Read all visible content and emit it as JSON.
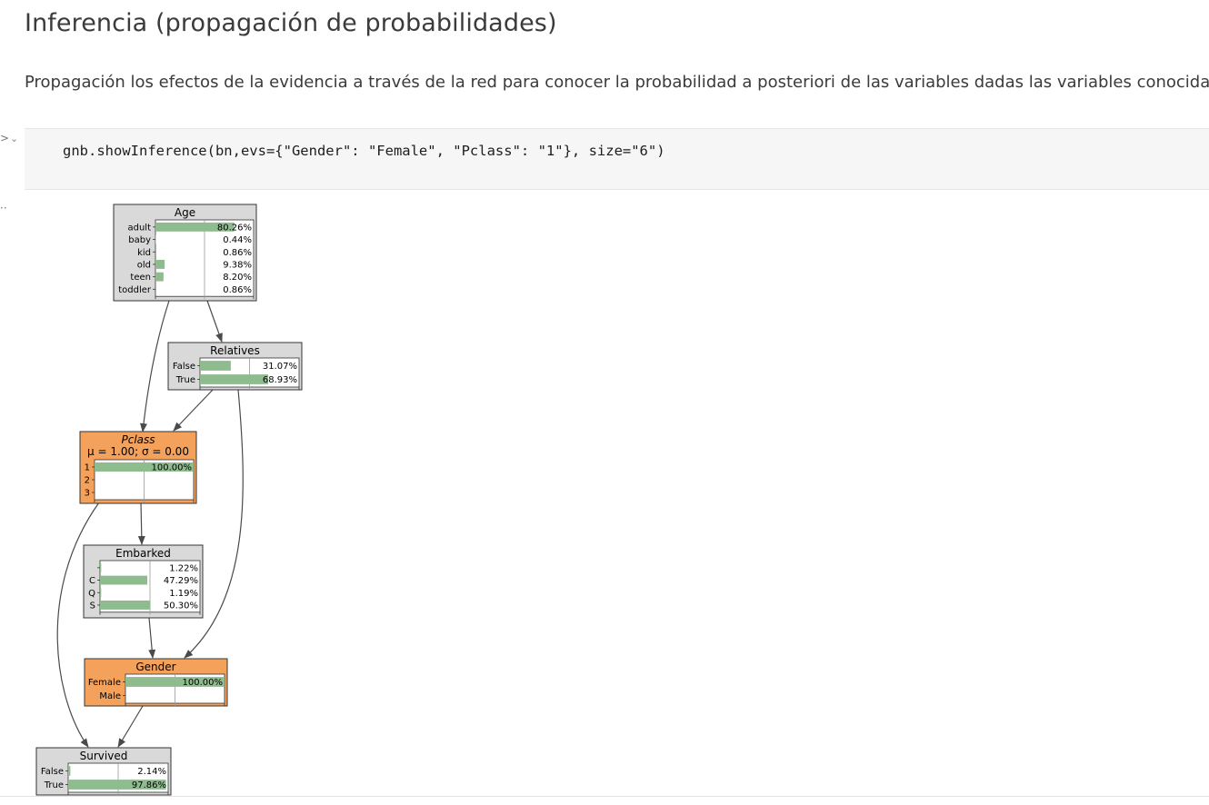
{
  "heading": "Inferencia (propagación de probabilidades)",
  "paragraph": "Propagación los efectos de la evidencia a través de la red para conocer la probabilidad a posteriori de las variables dadas las variables conocidas",
  "cell": {
    "prompt": ">",
    "collapse_icon": "chevron-down-icon",
    "code": "gnb.showInference(bn,evs={\"Gender\": \"Female\", \"Pclass\": \"1\"}, size=\"6\")",
    "output_prompt": "··"
  },
  "colors": {
    "bar": "#8fbc8f",
    "node_default": "#d9d9d9",
    "node_evidence": "#f4a15b",
    "edge": "#4a4a4a",
    "cell_bg": "#f6f6f6"
  },
  "nodes": {
    "age": {
      "title": "Age",
      "evidence": false,
      "states": [
        {
          "label": "adult",
          "value": 0.8026,
          "text": "80.26%"
        },
        {
          "label": "baby",
          "value": 0.0044,
          "text": "0.44%"
        },
        {
          "label": "kid",
          "value": 0.0086,
          "text": "0.86%"
        },
        {
          "label": "old",
          "value": 0.0938,
          "text": "9.38%"
        },
        {
          "label": "teen",
          "value": 0.082,
          "text": "8.20%"
        },
        {
          "label": "toddler",
          "value": 0.0086,
          "text": "0.86%"
        }
      ]
    },
    "relatives": {
      "title": "Relatives",
      "evidence": false,
      "states": [
        {
          "label": "False",
          "value": 0.3107,
          "text": "31.07%"
        },
        {
          "label": "True",
          "value": 0.6893,
          "text": "68.93%"
        }
      ]
    },
    "pclass": {
      "title": "Pclass",
      "subtitle": "μ = 1.00; σ = 0.00",
      "evidence": true,
      "states": [
        {
          "label": "1",
          "value": 1.0,
          "text": "100.00%"
        },
        {
          "label": "2",
          "value": 0.0,
          "text": ""
        },
        {
          "label": "3",
          "value": 0.0,
          "text": ""
        }
      ]
    },
    "embarked": {
      "title": "Embarked",
      "evidence": false,
      "states": [
        {
          "label": "",
          "value": 0.0122,
          "text": "1.22%"
        },
        {
          "label": "C",
          "value": 0.4729,
          "text": "47.29%"
        },
        {
          "label": "Q",
          "value": 0.0119,
          "text": "1.19%"
        },
        {
          "label": "S",
          "value": 0.503,
          "text": "50.30%"
        }
      ]
    },
    "gender": {
      "title": "Gender",
      "evidence": true,
      "states": [
        {
          "label": "Female",
          "value": 1.0,
          "text": "100.00%"
        },
        {
          "label": "Male",
          "value": 0.0,
          "text": ""
        }
      ]
    },
    "survived": {
      "title": "Survived",
      "evidence": false,
      "states": [
        {
          "label": "False",
          "value": 0.0214,
          "text": "2.14%"
        },
        {
          "label": "True",
          "value": 0.9786,
          "text": "97.86%"
        }
      ]
    }
  },
  "edges": [
    [
      "Age",
      "Relatives"
    ],
    [
      "Age",
      "Pclass"
    ],
    [
      "Relatives",
      "Pclass"
    ],
    [
      "Relatives",
      "Gender"
    ],
    [
      "Pclass",
      "Embarked"
    ],
    [
      "Pclass",
      "Survived"
    ],
    [
      "Embarked",
      "Gender"
    ],
    [
      "Gender",
      "Survived"
    ]
  ]
}
